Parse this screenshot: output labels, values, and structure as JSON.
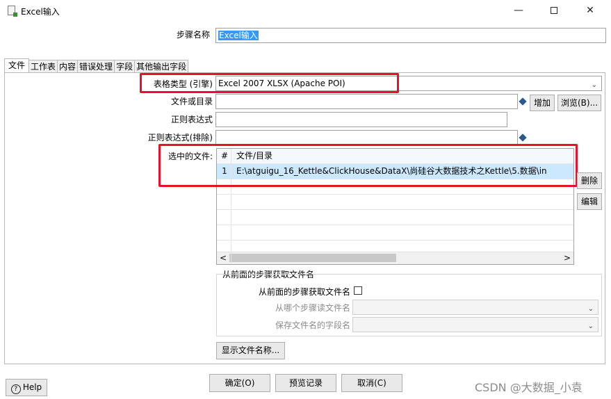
{
  "window": {
    "title": "Excel输入",
    "minimize": "—",
    "close": "✕"
  },
  "step_name": {
    "label": "步骤名称",
    "value": "Excel输入"
  },
  "tabs": [
    {
      "label": "文件"
    },
    {
      "label": "工作表"
    },
    {
      "label": "内容"
    },
    {
      "label": "错误处理"
    },
    {
      "label": "字段"
    },
    {
      "label": "其他输出字段"
    }
  ],
  "file_tab": {
    "spreadsheet_type_label": "表格类型 (引擎)",
    "spreadsheet_type_value": "Excel 2007 XLSX (Apache POI)",
    "file_or_dir_label": "文件或目录",
    "add_button": "增加",
    "browse_button": "浏览(B)...",
    "regex_label": "正则表达式",
    "regex_exclude_label": "正则表达式(排除)",
    "selected_files_label": "选中的文件:",
    "table": {
      "col_num": "#",
      "col_file": "文件/目录",
      "rows": [
        {
          "num": "1",
          "file": "E:\\atguigu_16_Kettle&ClickHouse&DataX\\尚硅谷大数据技术之Kettle\\5.数据\\in"
        }
      ]
    },
    "delete_button": "删除",
    "edit_button": "编辑",
    "scroll_left": "<",
    "scroll_right": ">",
    "from_prev_group": {
      "title": "从前面的步骤获取文件名",
      "checkbox_label": "从前面的步骤获取文件名",
      "read_from_step_label": "从哪个步骤读文件名",
      "field_name_label": "保存文件名的字段名"
    },
    "show_filenames_button": "显示文件名称..."
  },
  "footer": {
    "help_button": "Help",
    "ok_button": "确定(O)",
    "preview_button": "预览记录",
    "cancel_button": "取消(C)"
  },
  "watermark": "CSDN @大数据_小袁",
  "colors": {
    "highlight_red": "#e8102a",
    "selection_blue": "#3399ff",
    "row_highlight": "#cce8ff"
  }
}
